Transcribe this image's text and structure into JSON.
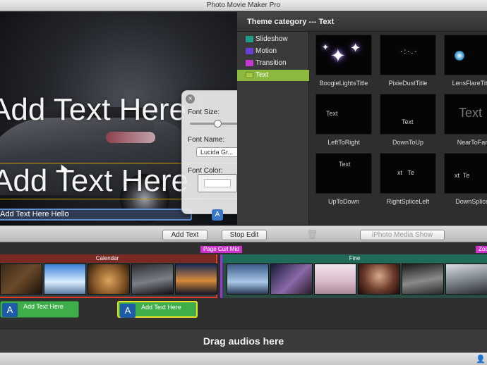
{
  "window": {
    "title": "Photo Movie Maker Pro"
  },
  "preview": {
    "overlay_text_1": "Add Text Here",
    "overlay_text_2": "Add Text Here Hello",
    "text_input_value": "Add Text Here Hello"
  },
  "font_popover": {
    "close_icon": "×",
    "font_size_label": "Font Size:",
    "font_size_level": 0.5,
    "font_name_label": "Font Name:",
    "font_name_value": "Lucida Gr...",
    "font_color_label": "Font Color:",
    "text_icon": "A"
  },
  "theme": {
    "header": "Theme category --- Text",
    "categories": [
      {
        "label": "Slideshow",
        "color": "#1f9d8a",
        "selected": false
      },
      {
        "label": "Motion",
        "color": "#6a3fd6",
        "selected": false
      },
      {
        "label": "Transition",
        "color": "#c23ad0",
        "selected": false
      },
      {
        "label": "Text",
        "color": "#a6c94a",
        "selected": true
      }
    ],
    "thumbnails": [
      {
        "caption": "BoogieLightsTitle"
      },
      {
        "caption": "PixieDustTitle"
      },
      {
        "caption": "LensFlareTitle"
      },
      {
        "caption": "LeftToRight",
        "preview_text": "Text"
      },
      {
        "caption": "DownToUp",
        "preview_text": "Text"
      },
      {
        "caption": "NearToFar",
        "preview_text": "Text"
      },
      {
        "caption": "UpToDown",
        "preview_text": "Text"
      },
      {
        "caption": "RightSpliceLeft",
        "preview_text": "xt   Te"
      },
      {
        "caption": "DownSplice",
        "preview_text": "xt  Te"
      }
    ]
  },
  "toolbar": {
    "add_text": "Add Text",
    "stop_edit": "Stop Edit",
    "iphoto_media_show": "iPhoto Media Show"
  },
  "timeline": {
    "transitions": [
      "Page Curl Mid",
      "Zoo"
    ],
    "groups": [
      {
        "label": "Calendar",
        "color": "#e03a2a"
      },
      {
        "label": "Fine",
        "color": "#2a8a6a"
      }
    ],
    "text_clips": [
      "Add Text Here",
      "Add Text Here"
    ]
  },
  "audio": {
    "placeholder": "Drag audios here"
  },
  "colors": {
    "accent": "#3d78c8",
    "selected_category": "#8cb93d",
    "text_clip": "#3fae4a"
  }
}
